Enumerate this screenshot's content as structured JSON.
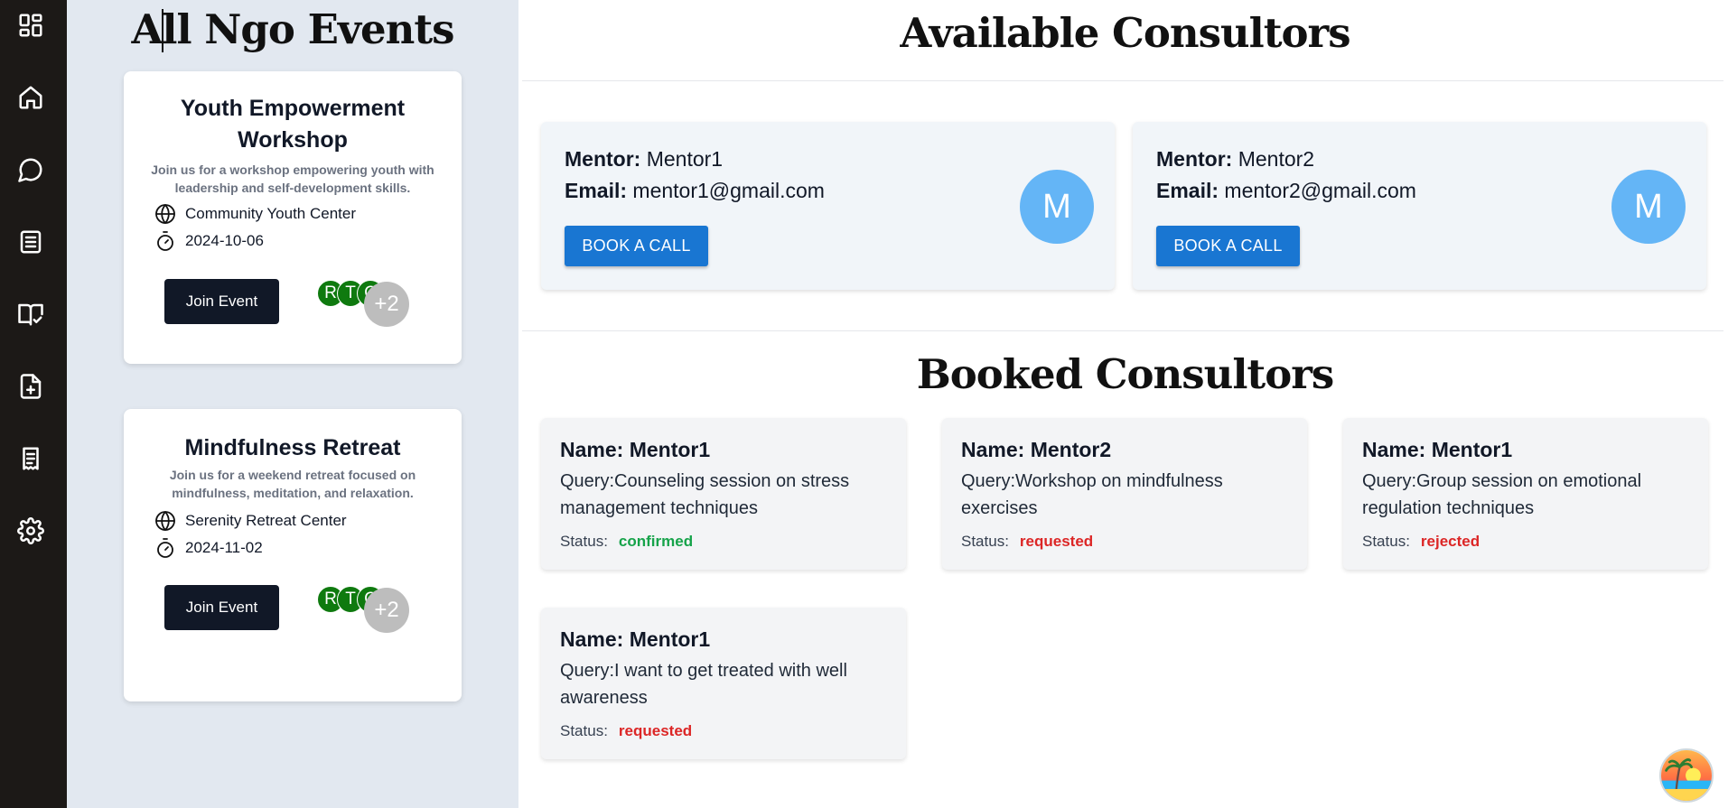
{
  "sidebar": {
    "items": [
      {
        "icon": "dashboard-icon"
      },
      {
        "icon": "home-icon"
      },
      {
        "icon": "chat-icon"
      },
      {
        "icon": "document-list-icon"
      },
      {
        "icon": "book-check-icon"
      },
      {
        "icon": "file-add-icon"
      },
      {
        "icon": "notes-icon"
      },
      {
        "icon": "settings-icon"
      }
    ]
  },
  "events_panel": {
    "title": "All Ngo Events",
    "events": [
      {
        "title": "Youth Empowerment Workshop",
        "description": "Join us for a workshop empowering youth with leadership and self-development skills.",
        "location": "Community Youth Center",
        "date": "2024-10-06",
        "join_label": "Join Event",
        "attendees": [
          "R",
          "T",
          "C"
        ],
        "more": "+2"
      },
      {
        "title": "Mindfulness Retreat",
        "description": "Join us for a weekend retreat focused on mindfulness, meditation, and relaxation.",
        "location": "Serenity Retreat Center",
        "date": "2024-11-02",
        "join_label": "Join Event",
        "attendees": [
          "R",
          "T",
          "C"
        ],
        "more": "+2"
      }
    ]
  },
  "available": {
    "title": "Available Consultors",
    "mentor_label": "Mentor:",
    "email_label": "Email:",
    "consultors": [
      {
        "name": "Mentor1",
        "email": "mentor1@gmail.com",
        "button": "BOOK A CALL",
        "initial": "M"
      },
      {
        "name": "Mentor2",
        "email": "mentor2@gmail.com",
        "button": "BOOK A CALL",
        "initial": "M"
      }
    ]
  },
  "booked": {
    "title": "Booked Consultors",
    "status_label": "Status:",
    "items": [
      {
        "name": "Name: Mentor1",
        "query": "Query:Counseling session on stress management techniques",
        "status": "confirmed",
        "status_color": "#16a34a"
      },
      {
        "name": "Name: Mentor2",
        "query": "Query:Workshop on mindfulness exercises",
        "status": "requested",
        "status_color": "#dc2626"
      },
      {
        "name": "Name: Mentor1",
        "query": "Query:Group session on emotional regulation techniques",
        "status": "rejected",
        "status_color": "#dc2626"
      },
      {
        "name": "Name: Mentor1",
        "query": "Query:I want to get treated with well awareness",
        "status": "requested",
        "status_color": "#dc2626"
      }
    ]
  },
  "colors": {
    "rail": "#1c1917",
    "events_bg": "#e2e8f0",
    "book_button": "#1976d2",
    "mentor_avatar": "#64b5f6",
    "attendee_avatar": "#0f7a0f"
  }
}
